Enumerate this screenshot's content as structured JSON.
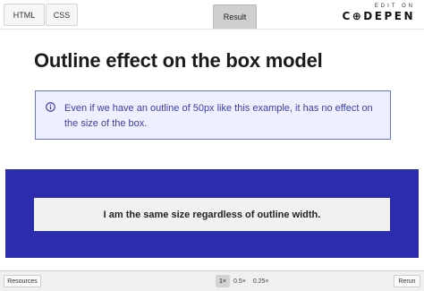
{
  "tabs": {
    "html": "HTML",
    "css": "CSS",
    "result": "Result"
  },
  "brand": {
    "edit_on": "EDIT ON",
    "name": "C⊕DEPEN"
  },
  "page": {
    "title": "Outline effect on the box model",
    "callout": "Even if we have an outline of 50px like this example, it has no effect on the size of the box.",
    "box_text": "I am the same size regardless of outline width."
  },
  "footer": {
    "resources": "Resources",
    "zoom": [
      "1×",
      "0.5×",
      "0.25×"
    ],
    "rerun": "Rerun"
  },
  "colors": {
    "demo_background": "#2b2dae",
    "callout_border": "#6674d8",
    "callout_text": "#3a3ea8"
  }
}
